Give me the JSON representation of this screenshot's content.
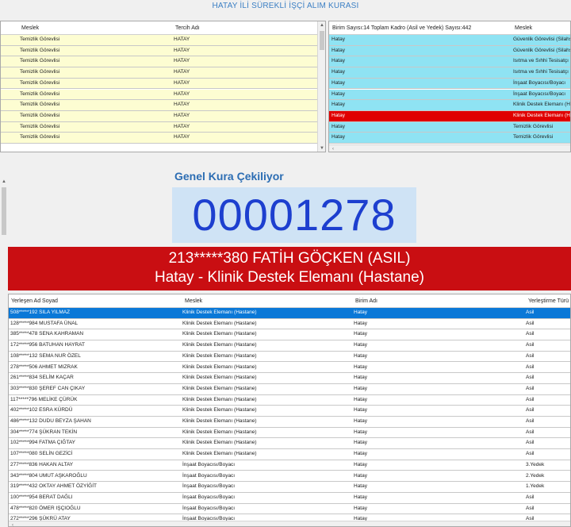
{
  "header": {
    "title": "HATAY İLİ SÜREKLİ İŞÇİ ALIM KURASI"
  },
  "preference_grid": {
    "columns": [
      "Meslek",
      "Tercih Adı"
    ],
    "rows": [
      [
        "Temizlik Görevlisi",
        "HATAY"
      ],
      [
        "Temizlik Görevlisi",
        "HATAY"
      ],
      [
        "Temizlik Görevlisi",
        "HATAY"
      ],
      [
        "Temizlik Görevlisi",
        "HATAY"
      ],
      [
        "Temizlik Görevlisi",
        "HATAY"
      ],
      [
        "Temizlik Görevlisi",
        "HATAY"
      ],
      [
        "Temizlik Görevlisi",
        "HATAY"
      ],
      [
        "Temizlik Görevlisi",
        "HATAY"
      ],
      [
        "Temizlik Görevlisi",
        "HATAY"
      ],
      [
        "Temizlik Görevlisi",
        "HATAY"
      ]
    ]
  },
  "unit_grid": {
    "columns": [
      "Birim Sayısı:14 Toplam Kadro (Asil ve Yedek) Sayısı:442",
      "Meslek"
    ],
    "selected_index": 7,
    "rows": [
      [
        "Hatay",
        "Güvenlik Görevlisi (Silahsız)"
      ],
      [
        "Hatay",
        "Güvenlik Görevlisi (Silahsız)"
      ],
      [
        "Hatay",
        "Isıtma ve Sıhhi Tesisatçı"
      ],
      [
        "Hatay",
        "Isıtma ve Sıhhi Tesisatçı"
      ],
      [
        "Hatay",
        "İnşaat Boyacısı/Boyacı"
      ],
      [
        "Hatay",
        "İnşaat Boyacısı/Boyacı"
      ],
      [
        "Hatay",
        "Klinik Destek Elemanı (Hastane)"
      ],
      [
        "Hatay",
        "Klinik Destek Elemanı (Hastane)"
      ],
      [
        "Hatay",
        "Temizlik Görevlisi"
      ],
      [
        "Hatay",
        "Temizlik Görevlisi"
      ]
    ]
  },
  "draw": {
    "heading": "Genel Kura Çekiliyor",
    "counter": "00001278",
    "winner_line1": "213*****380 FATİH GÖÇKEN (ASIL)",
    "winner_line2": "Hatay - Klinik Destek Elemanı (Hastane)"
  },
  "placement_grid": {
    "columns": [
      "Yerleşen Ad Soyad",
      "Meslek",
      "Birim Adı",
      "Yerleştirme Türü"
    ],
    "selected_index": 0,
    "rows": [
      [
        "508*****192 SILA YILMAZ",
        "Klinik Destek Elemanı (Hastane)",
        "Hatay",
        "Asil"
      ],
      [
        "128*****984 MUSTAFA ÜNAL",
        "Klinik Destek Elemanı (Hastane)",
        "Hatay",
        "Asil"
      ],
      [
        "385*****478 SENA KAHRAMAN",
        "Klinik Destek Elemanı (Hastane)",
        "Hatay",
        "Asil"
      ],
      [
        "172*****956 BATUHAN HAYRAT",
        "Klinik Destek Elemanı (Hastane)",
        "Hatay",
        "Asil"
      ],
      [
        "108*****132 SEMA NUR ÖZEL",
        "Klinik Destek Elemanı (Hastane)",
        "Hatay",
        "Asil"
      ],
      [
        "278*****506 AHMET MIZRAK",
        "Klinik Destek Elemanı (Hastane)",
        "Hatay",
        "Asil"
      ],
      [
        "261*****834 SELİM KAÇAR",
        "Klinik Destek Elemanı (Hastane)",
        "Hatay",
        "Asil"
      ],
      [
        "303*****830 ŞEREF CAN ÇIKAY",
        "Klinik Destek Elemanı (Hastane)",
        "Hatay",
        "Asil"
      ],
      [
        "117*****796 MELİKE ÇÜRÜK",
        "Klinik Destek Elemanı (Hastane)",
        "Hatay",
        "Asil"
      ],
      [
        "402*****102 ESRA KÜRDÜ",
        "Klinik Destek Elemanı (Hastane)",
        "Hatay",
        "Asil"
      ],
      [
        "486*****132 DUDU BEYZA ŞAHAN",
        "Klinik Destek Elemanı (Hastane)",
        "Hatay",
        "Asil"
      ],
      [
        "304*****774 ŞÜKRAN TEKİN",
        "Klinik Destek Elemanı (Hastane)",
        "Hatay",
        "Asil"
      ],
      [
        "102*****994 FATMA ÇIĞTAY",
        "Klinik Destek Elemanı (Hastane)",
        "Hatay",
        "Asil"
      ],
      [
        "107*****080 SELİN GEZİCİ",
        "Klinik Destek Elemanı (Hastane)",
        "Hatay",
        "Asil"
      ],
      [
        "277*****836 HAKAN ALTAY",
        "İnşaat Boyacısı/Boyacı",
        "Hatay",
        "3.Yedek"
      ],
      [
        "343*****804 UMUT AŞKAROĞLU",
        "İnşaat Boyacısı/Boyacı",
        "Hatay",
        "2.Yedek"
      ],
      [
        "319*****432 OKTAY AHMET ÖZYİĞİT",
        "İnşaat Boyacısı/Boyacı",
        "Hatay",
        "1.Yedek"
      ],
      [
        "100*****954 BERAT DAĞLI",
        "İnşaat Boyacısı/Boyacı",
        "Hatay",
        "Asil"
      ],
      [
        "478*****820 ÖMER IŞÇIOĞLU",
        "İnşaat Boyacısı/Boyacı",
        "Hatay",
        "Asil"
      ],
      [
        "272*****296 ŞÜKRÜ ATAY",
        "İnşaat Boyacısı/Boyacı",
        "Hatay",
        "Asil"
      ]
    ]
  }
}
